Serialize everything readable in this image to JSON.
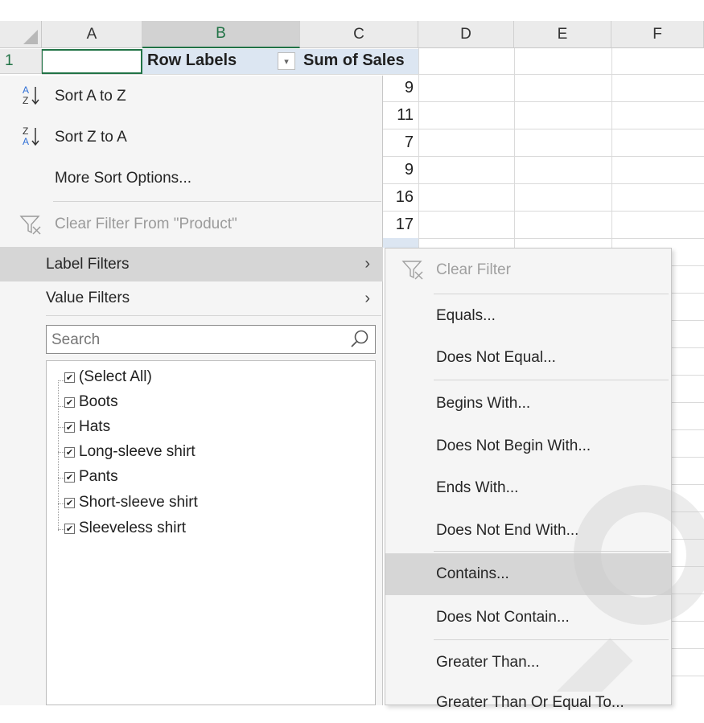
{
  "spreadsheet": {
    "columns": [
      "A",
      "B",
      "C",
      "D",
      "E",
      "F"
    ],
    "row1_number": "1",
    "pivot_row_labels": "Row Labels",
    "pivot_sum_header": "Sum of Sales",
    "values": [
      "9",
      "11",
      "7",
      "9",
      "16",
      "17"
    ]
  },
  "menu": {
    "sort_a_to_z": "Sort A to Z",
    "sort_z_to_a": "Sort Z to A",
    "more_sort_options": "More Sort Options...",
    "clear_filter_from": "Clear Filter From \"Product\"",
    "label_filters": "Label Filters",
    "value_filters": "Value Filters",
    "search_placeholder": "Search",
    "items": [
      "(Select All)",
      "Boots",
      "Hats",
      "Long-sleeve shirt",
      "Pants",
      "Short-sleeve shirt",
      "Sleeveless shirt"
    ]
  },
  "submenu": {
    "clear_filter": "Clear Filter",
    "equals": "Equals...",
    "does_not_equal": "Does Not Equal...",
    "begins_with": "Begins With...",
    "does_not_begin_with": "Does Not Begin With...",
    "ends_with": "Ends With...",
    "does_not_end_with": "Does Not End With...",
    "contains": "Contains...",
    "does_not_contain": "Does Not Contain...",
    "greater_than": "Greater Than...",
    "greater_than_or_equal": "Greater Than Or Equal To..."
  },
  "colors": {
    "accent_green": "#217346",
    "menu_bg": "#f5f5f5",
    "hover_bg": "#d6d6d6",
    "pivot_header_bg": "#dce6f2"
  }
}
